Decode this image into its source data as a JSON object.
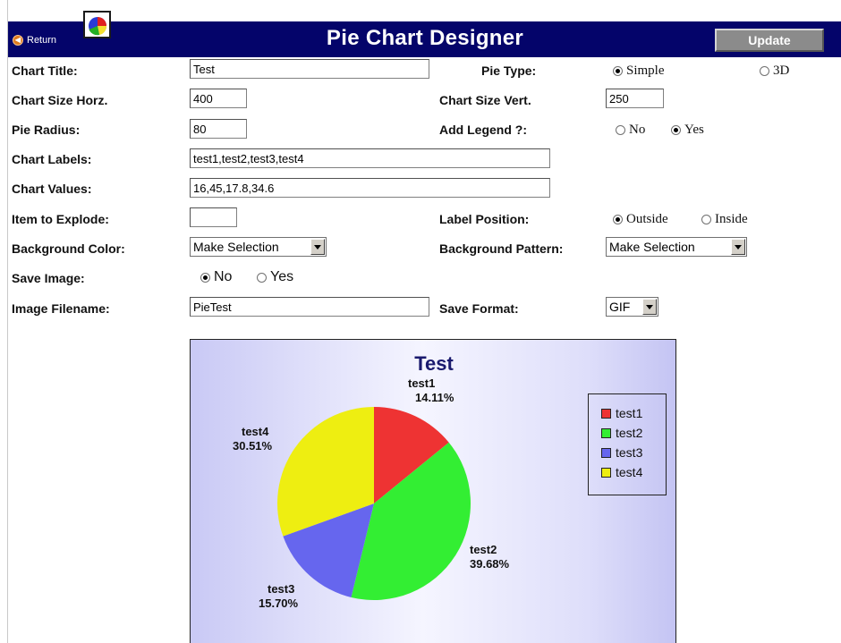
{
  "header": {
    "return_label": "Return",
    "title": "Pie Chart Designer",
    "update_label": "Update"
  },
  "form": {
    "chart_title": {
      "label": "Chart Title:",
      "value": "Test"
    },
    "pie_type": {
      "label": "Pie Type:",
      "options": [
        "Simple",
        "3D"
      ],
      "selected": "Simple"
    },
    "chart_size_horz": {
      "label": "Chart Size Horz.",
      "value": "400"
    },
    "chart_size_vert": {
      "label": "Chart Size Vert.",
      "value": "250"
    },
    "pie_radius": {
      "label": "Pie Radius:",
      "value": "80"
    },
    "add_legend": {
      "label": "Add Legend ?:",
      "options": [
        "No",
        "Yes"
      ],
      "selected": "Yes"
    },
    "chart_labels": {
      "label": "Chart Labels:",
      "value": "test1,test2,test3,test4"
    },
    "chart_values": {
      "label": "Chart Values:",
      "value": "16,45,17.8,34.6"
    },
    "item_to_explode": {
      "label": "Item to Explode:",
      "value": ""
    },
    "label_position": {
      "label": "Label Position:",
      "options": [
        "Outside",
        "Inside"
      ],
      "selected": "Outside"
    },
    "background_color": {
      "label": "Background Color:",
      "value": "Make Selection"
    },
    "background_pattern": {
      "label": "Background Pattern:",
      "value": "Make Selection"
    },
    "save_image": {
      "label": "Save Image:",
      "options": [
        "No",
        "Yes"
      ],
      "selected": "No"
    },
    "image_filename": {
      "label": "Image Filename:",
      "value": "PieTest"
    },
    "save_format": {
      "label": "Save Format:",
      "value": "GIF"
    }
  },
  "colors": {
    "header_bg": "#04046a",
    "slice1": "#ee3333",
    "slice2": "#33ee33",
    "slice3": "#6666ee",
    "slice4": "#eeee11"
  },
  "chart_data": {
    "type": "pie",
    "title": "Test",
    "categories": [
      "test1",
      "test2",
      "test3",
      "test4"
    ],
    "values": [
      16,
      45,
      17.8,
      34.6
    ],
    "percent_labels": [
      "14.11%",
      "39.68%",
      "15.70%",
      "30.51%"
    ],
    "colors": [
      "#ee3333",
      "#33ee33",
      "#6666ee",
      "#eeee11"
    ],
    "legend_position": "right"
  }
}
